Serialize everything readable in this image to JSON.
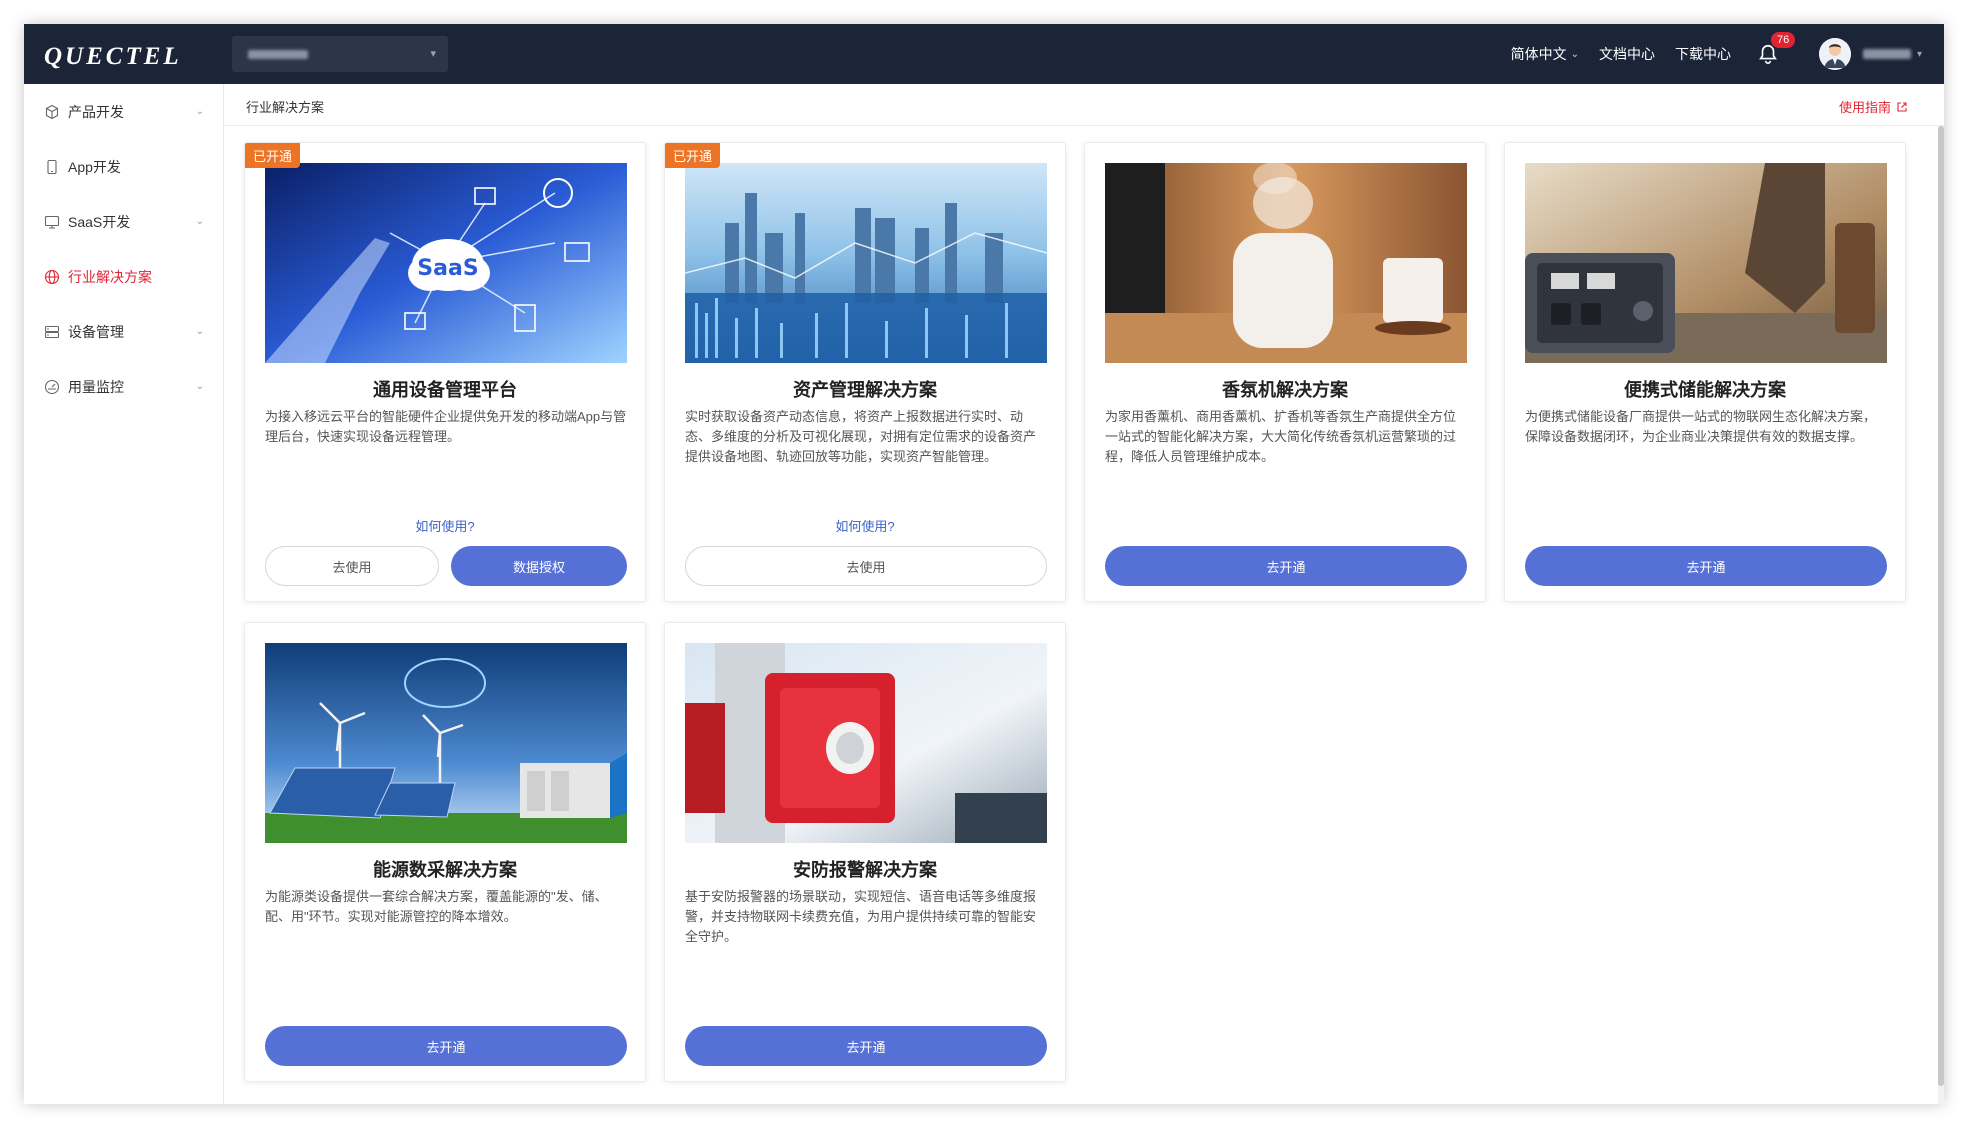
{
  "header": {
    "logo": "QUECTEL",
    "language": "简体中文",
    "docs": "文档中心",
    "download": "下载中心",
    "notification_count": "76"
  },
  "sidebar": {
    "items": [
      {
        "label": "产品开发",
        "icon": "cube-icon",
        "expandable": true
      },
      {
        "label": "App开发",
        "icon": "phone-icon",
        "expandable": false
      },
      {
        "label": "SaaS开发",
        "icon": "monitor-icon",
        "expandable": true
      },
      {
        "label": "行业解决方案",
        "icon": "globe-icon",
        "expandable": false,
        "active": true
      },
      {
        "label": "设备管理",
        "icon": "server-icon",
        "expandable": true
      },
      {
        "label": "用量监控",
        "icon": "gauge-icon",
        "expandable": true
      }
    ]
  },
  "main": {
    "breadcrumb": "行业解决方案",
    "guide_link": "使用指南"
  },
  "cards": [
    {
      "tag": "已开通",
      "title": "通用设备管理平台",
      "desc": "为接入移远云平台的智能硬件企业提供免开发的移动端App与管理后台，快速实现设备远程管理。",
      "howto": "如何使用?",
      "btn1": "去使用",
      "btn2": "数据授权"
    },
    {
      "tag": "已开通",
      "title": "资产管理解决方案",
      "desc": "实时获取设备资产动态信息，将资产上报数据进行实时、动态、多维度的分析及可视化展现，对拥有定位需求的设备资产提供设备地图、轨迹回放等功能，实现资产智能管理。",
      "howto": "如何使用?",
      "btn1": "去使用"
    },
    {
      "title": "香氛机解决方案",
      "desc": "为家用香薰机、商用香薰机、扩香机等香氛生产商提供全方位一站式的智能化解决方案，大大简化传统香氛机运营繁琐的过程，降低人员管理维护成本。",
      "btn1": "去开通"
    },
    {
      "title": "便携式储能解决方案",
      "desc": "为便携式储能设备厂商提供一站式的物联网生态化解决方案，保障设备数据闭环，为企业商业决策提供有效的数据支撑。",
      "btn1": "去开通"
    },
    {
      "title": "能源数采解决方案",
      "desc": "为能源类设备提供一套综合解决方案，覆盖能源的\"发、储、配、用\"环节。实现对能源管控的降本增效。",
      "btn1": "去开通"
    },
    {
      "title": "安防报警解决方案",
      "desc": "基于安防报警器的场景联动，实现短信、语音电话等多维度报警，并支持物联网卡续费充值，为用户提供持续可靠的智能安全守护。",
      "btn1": "去开通"
    }
  ]
}
